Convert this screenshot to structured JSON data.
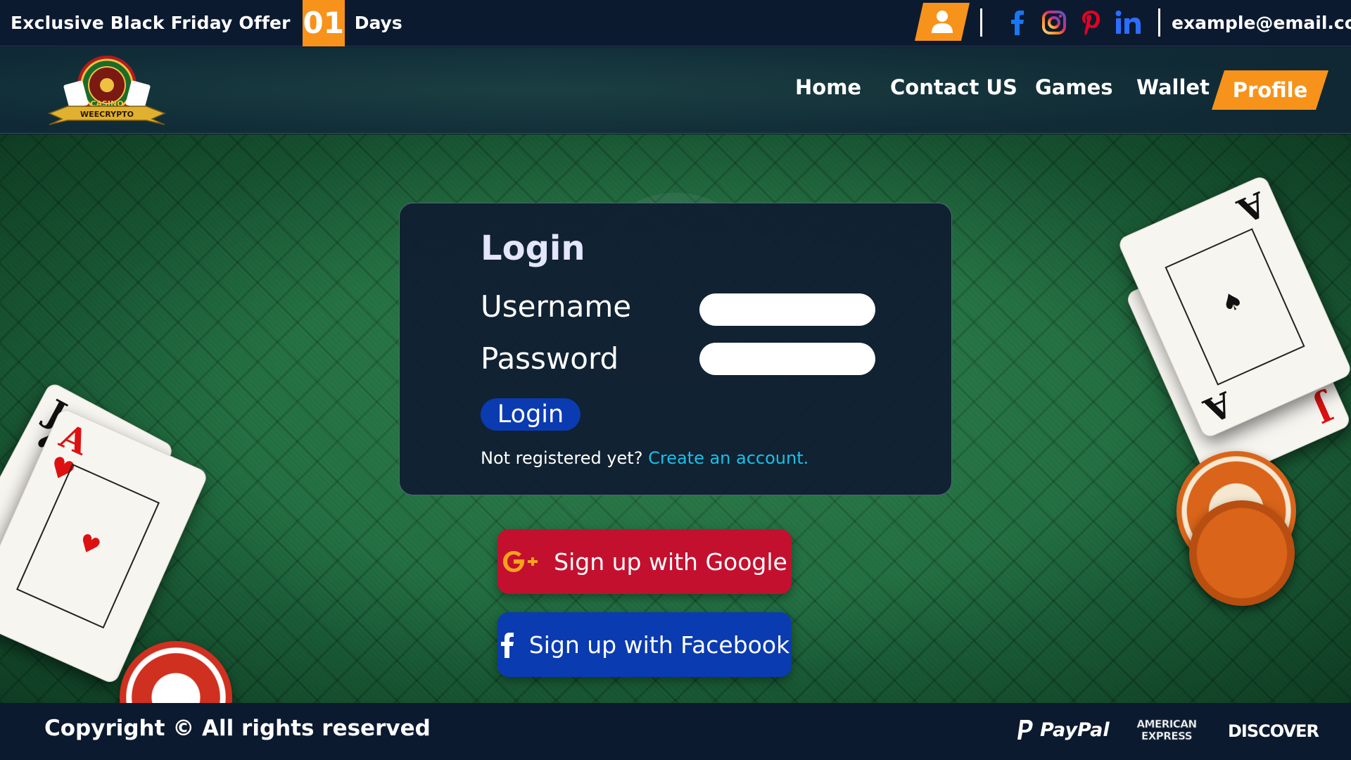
{
  "topbar": {
    "offer_text": "Exclusive Black Friday Offer",
    "offer_count": "01",
    "offer_unit": "Days",
    "user_icon": "user-icon",
    "socials": [
      "facebook-icon",
      "instagram-icon",
      "pinterest-icon",
      "linkedin-icon"
    ],
    "email": "example@email.com"
  },
  "nav": {
    "logo_icon": "weecrypto-roulette-logo",
    "items": [
      {
        "label": "Home"
      },
      {
        "label": "Contact US"
      },
      {
        "label": "Games"
      },
      {
        "label": "Wallet"
      },
      {
        "label": "Profile",
        "active": true
      }
    ]
  },
  "login": {
    "title": "Login",
    "username_label": "Username",
    "username_value": "",
    "password_label": "Password",
    "password_value": "",
    "button_label": "Login",
    "not_registered": "Not registered yet?",
    "create_account": "Create an account."
  },
  "signup": {
    "google": {
      "label": "Sign up with Google",
      "icon": "google-plus-icon"
    },
    "facebook": {
      "label": "Sign up with Facebook",
      "icon": "facebook-icon"
    }
  },
  "footer": {
    "copyright": "Copyright © All rights reserved",
    "payments": [
      "PayPal",
      "AMERICAN EXPRESS",
      "DISCOVER"
    ]
  },
  "colors": {
    "accent_orange": "#f7931a",
    "dark_navy": "#0c1a30",
    "login_blue": "#0b3bb0",
    "google_red": "#c4102f",
    "link_cyan": "#17c1e8",
    "felt_green": "#1f6a3f"
  }
}
